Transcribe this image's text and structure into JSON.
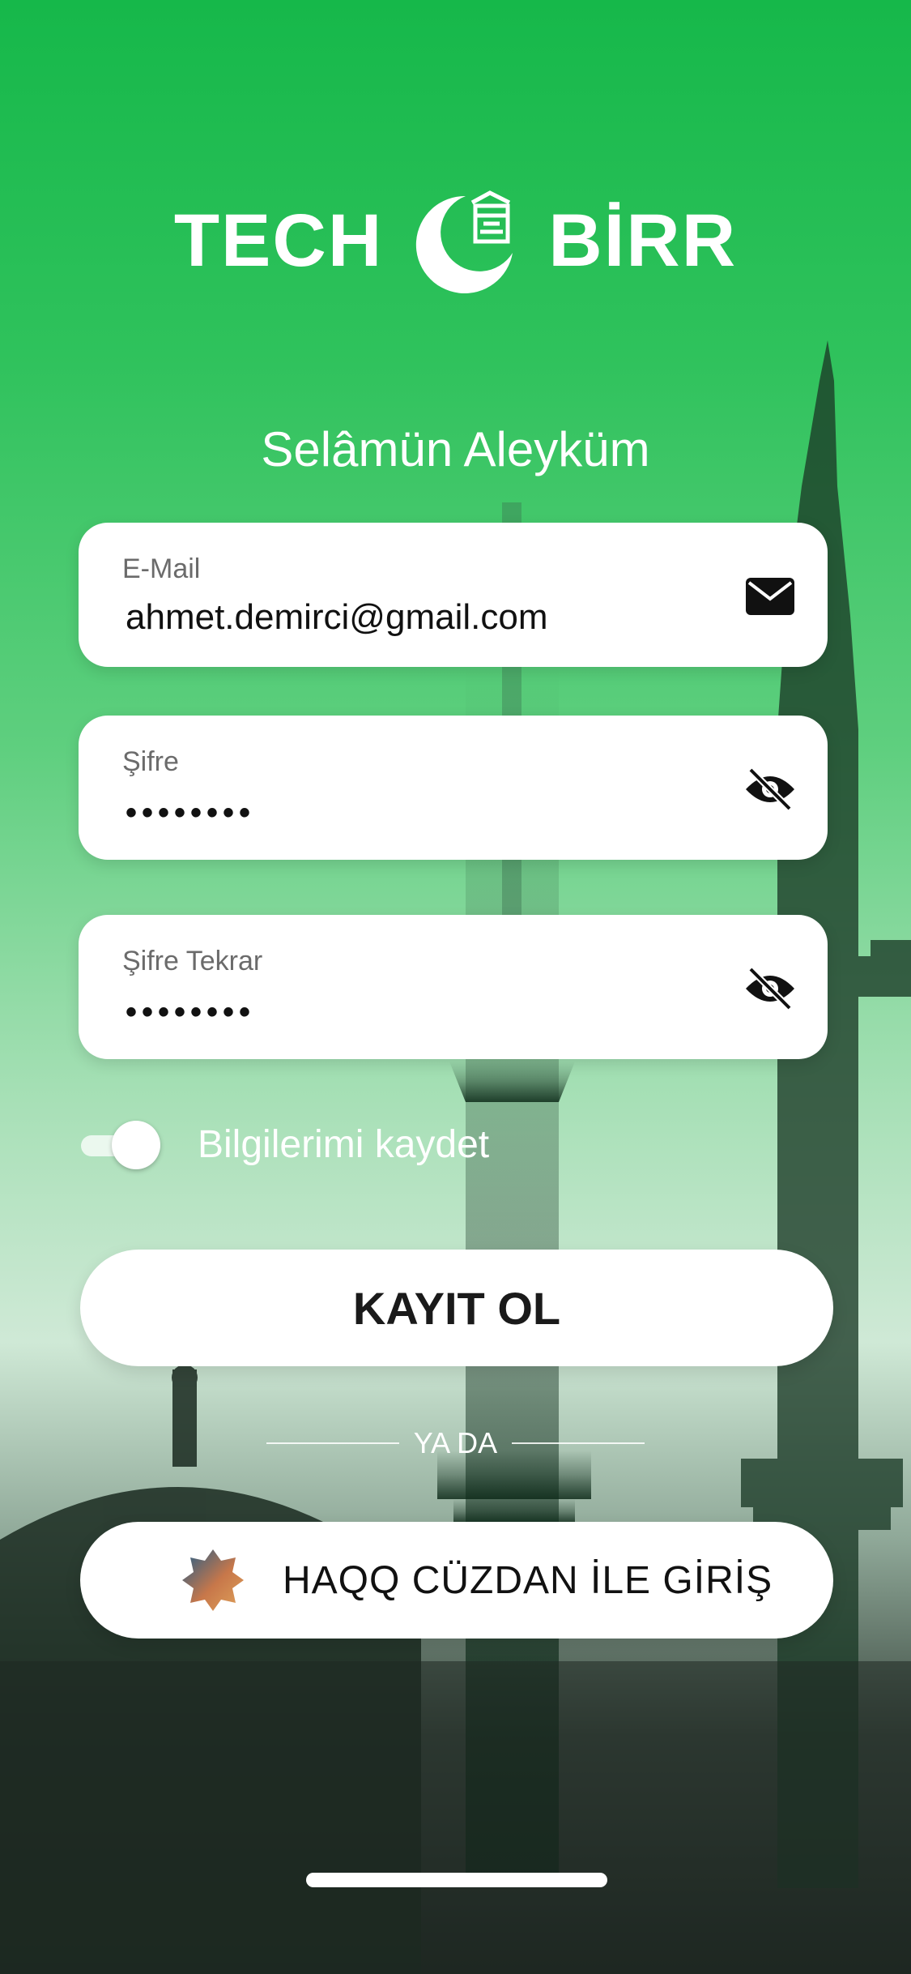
{
  "logo": {
    "left_text": "TECH",
    "right_text": "BİRR",
    "mark_icon": "crescent-kaaba-icon"
  },
  "greeting": "Selâmün Aleyküm",
  "fields": {
    "email": {
      "label": "E-Mail",
      "value": "ahmet.demirci@gmail.com",
      "icon": "mail-icon"
    },
    "password": {
      "label": "Şifre",
      "value": "••••••••",
      "icon": "eye-off-icon"
    },
    "password_repeat": {
      "label": "Şifre Tekrar",
      "value": "••••••••",
      "icon": "eye-off-icon"
    }
  },
  "remember": {
    "label": "Bilgilerimi kaydet",
    "enabled": true
  },
  "register_button": "KAYIT OL",
  "divider_text": "YA DA",
  "haqq_button": {
    "label": "HAQQ CÜZDAN İLE GİRİŞ",
    "icon": "haqq-star-icon"
  },
  "colors": {
    "brand_green": "#16b84a",
    "button_bg": "#ffffff",
    "text_dark": "#1a1a1a"
  }
}
